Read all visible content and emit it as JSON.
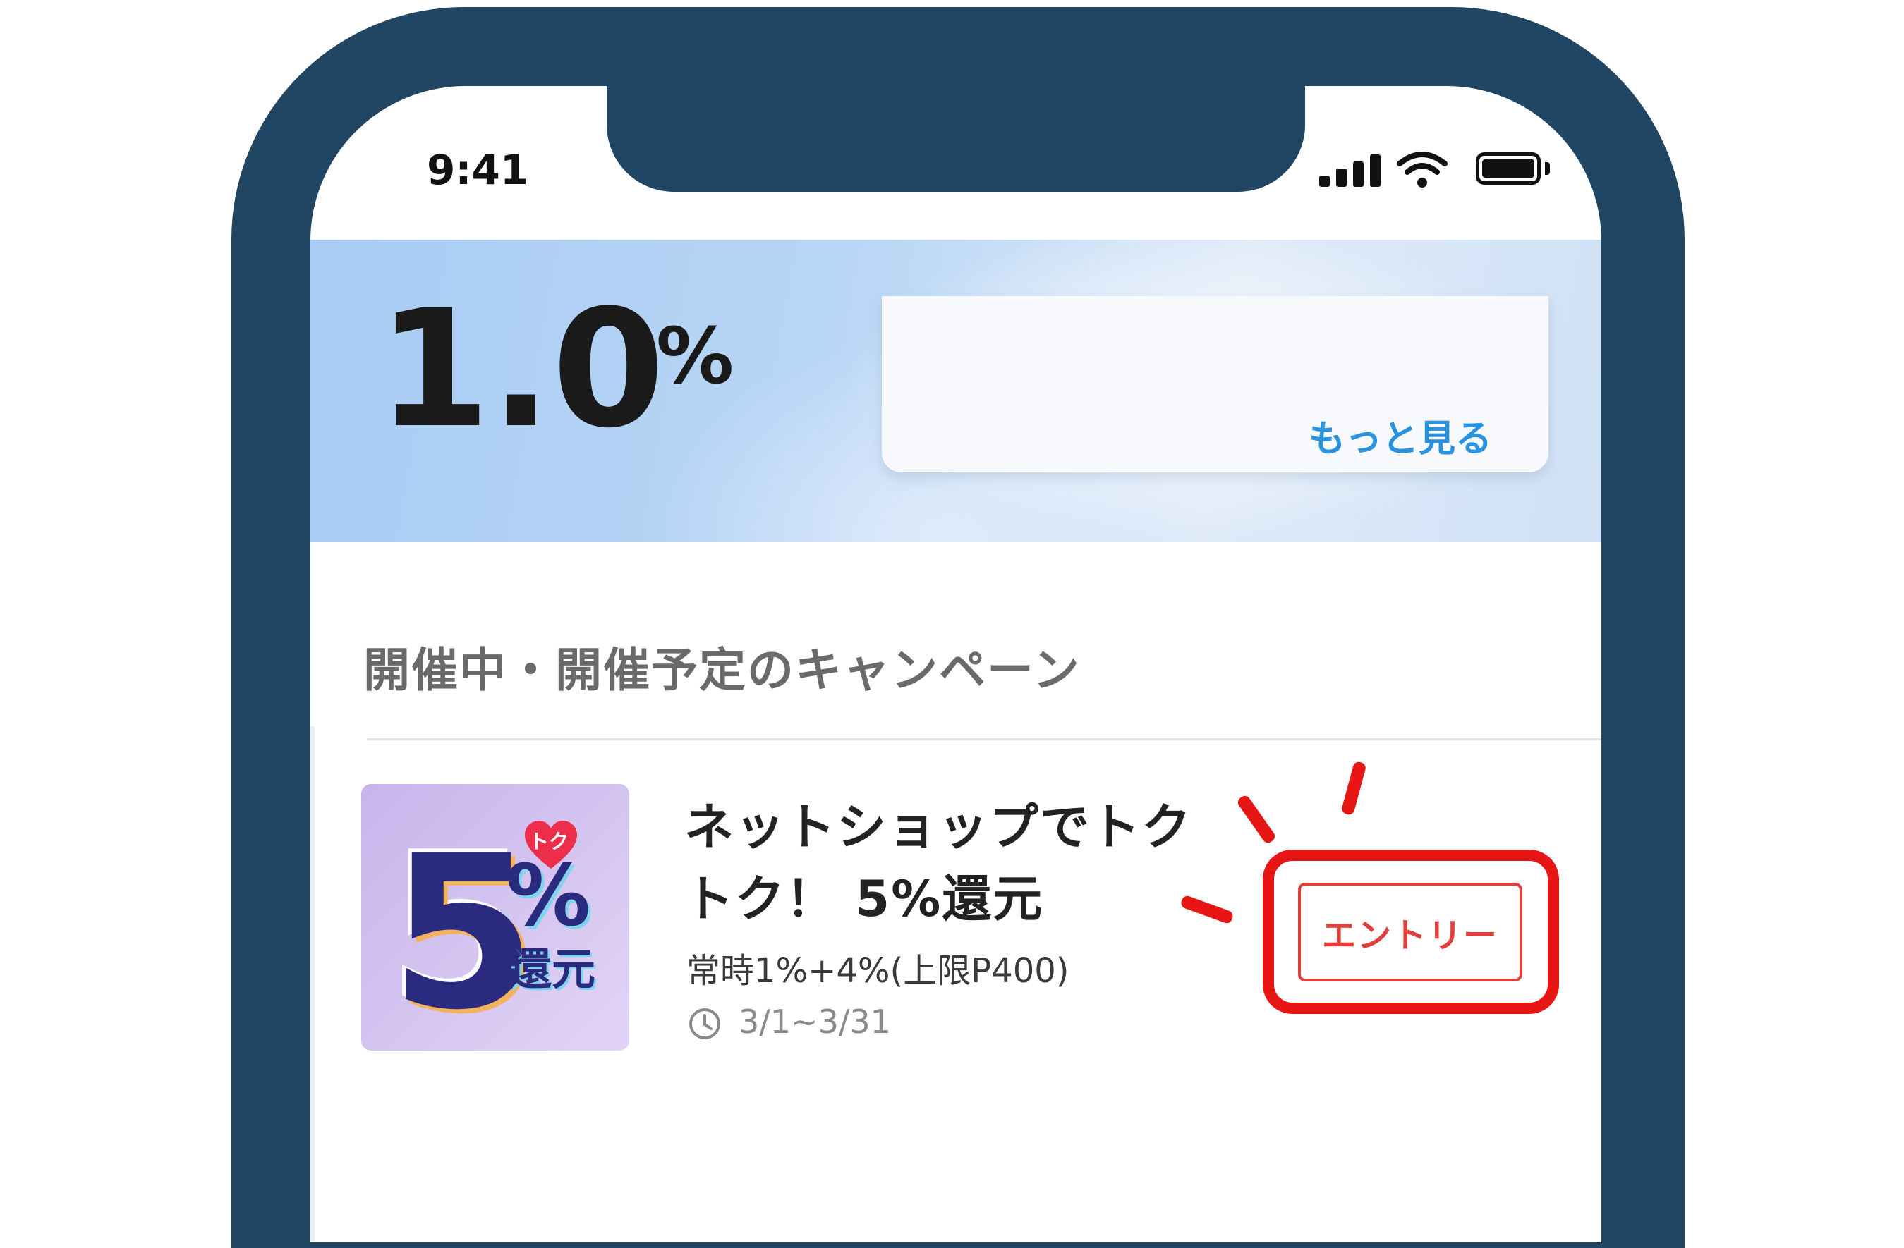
{
  "status_bar": {
    "time": "9:41"
  },
  "hero": {
    "rate_number": "1.0",
    "rate_unit": "%",
    "more_link": "もっと見る"
  },
  "campaigns": {
    "section_title": "開催中・開催予定のキャンペーン",
    "items": [
      {
        "thumbnail": {
          "big_number": "5",
          "percent": "%",
          "kanji": "還元",
          "badge": "トク"
        },
        "title": "ネットショップでトクトク！ 5%還元",
        "subtitle": "常時1%+4%(上限P400)",
        "period": "3/1~3/31",
        "entry_label": "エントリー"
      }
    ]
  },
  "colors": {
    "frame": "#214663",
    "accent_blue": "#2a93e0",
    "entry_red": "#e0403a",
    "highlight_red": "#e81515"
  },
  "icons": [
    "signal-icon",
    "wifi-icon",
    "battery-icon",
    "clock-icon"
  ]
}
